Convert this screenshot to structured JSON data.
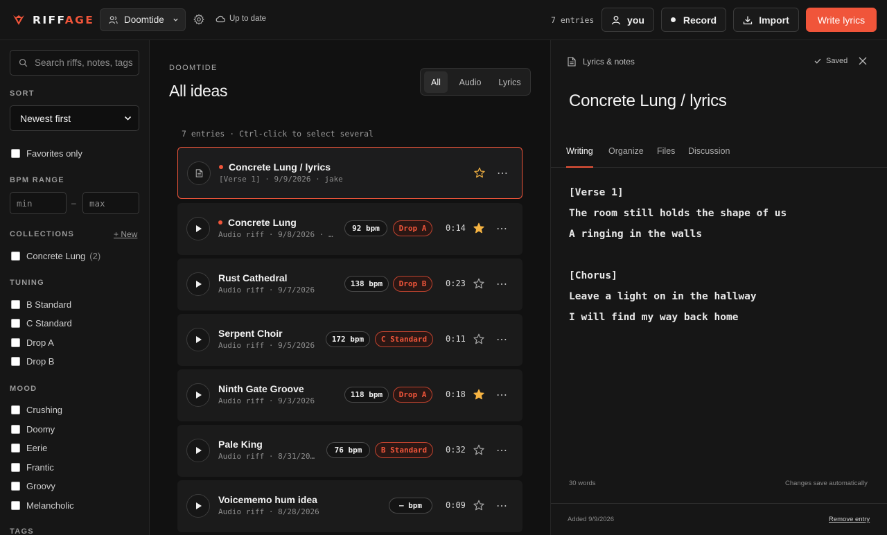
{
  "app": {
    "brand_part1": "RIFF",
    "brand_part2": "AGE",
    "brand_color": "#f0553a",
    "accent_color": "#f0553a",
    "star_color": "#f5b342"
  },
  "header": {
    "project_name": "Doomtide",
    "sync_status": "Up to date",
    "entries_count": "7 entries",
    "user_label": "you",
    "record_label": "Record",
    "import_label": "Import",
    "write_lyrics_label": "Write lyrics"
  },
  "sidebar": {
    "search_placeholder": "Search riffs, notes, tags",
    "sort_label": "SORT",
    "sort_value": "Newest first",
    "favorites_label": "Favorites only",
    "bpm_label": "BPM RANGE",
    "bpm_min_placeholder": "min",
    "bpm_max_placeholder": "max",
    "bpm_dash": "–",
    "collections_label": "COLLECTIONS",
    "new_link": "+ New",
    "collections": [
      {
        "label": "Concrete Lung",
        "count": "(2)"
      }
    ],
    "tuning_label": "TUNING",
    "tunings": [
      "B Standard",
      "C Standard",
      "Drop A",
      "Drop B"
    ],
    "mood_label": "MOOD",
    "moods": [
      "Crushing",
      "Doomy",
      "Eerie",
      "Frantic",
      "Groovy",
      "Melancholic"
    ],
    "tags_label": "TAGS"
  },
  "main": {
    "breadcrumb": "DOOMTIDE",
    "title": "All ideas",
    "filters": [
      "All",
      "Audio",
      "Lyrics"
    ],
    "active_filter": "All",
    "list_info": "7 entries · Ctrl-click to select several",
    "entries": [
      {
        "name": "Concrete Lung / lyrics",
        "sub": "[Verse 1] · 9/9/2026 · jake",
        "kind": "lyrics",
        "dot": true,
        "bpm": "",
        "tuning": "",
        "duration": "",
        "favorite": false,
        "selected": true
      },
      {
        "name": "Concrete Lung",
        "sub": "Audio riff · 9/8/2026 · …",
        "kind": "audio",
        "dot": true,
        "bpm": "92 bpm",
        "tuning": "Drop A",
        "duration": "0:14",
        "favorite": true,
        "selected": false
      },
      {
        "name": "Rust Cathedral",
        "sub": "Audio riff · 9/7/2026",
        "kind": "audio",
        "dot": false,
        "bpm": "138 bpm",
        "tuning": "Drop B",
        "duration": "0:23",
        "favorite": false,
        "selected": false
      },
      {
        "name": "Serpent Choir",
        "sub": "Audio riff · 9/5/2026",
        "kind": "audio",
        "dot": false,
        "bpm": "172 bpm",
        "tuning": "C Standard",
        "duration": "0:11",
        "favorite": false,
        "selected": false
      },
      {
        "name": "Ninth Gate Groove",
        "sub": "Audio riff · 9/3/2026",
        "kind": "audio",
        "dot": false,
        "bpm": "118 bpm",
        "tuning": "Drop A",
        "duration": "0:18",
        "favorite": true,
        "selected": false
      },
      {
        "name": "Pale King",
        "sub": "Audio riff · 8/31/20…",
        "kind": "audio",
        "dot": false,
        "bpm": "76 bpm",
        "tuning": "B Standard",
        "duration": "0:32",
        "favorite": false,
        "selected": false
      },
      {
        "name": "Voicememo hum idea",
        "sub": "Audio riff · 8/28/2026",
        "kind": "audio",
        "dot": false,
        "bpm": "– bpm",
        "tuning": "",
        "duration": "0:09",
        "favorite": false,
        "selected": false
      }
    ]
  },
  "panel": {
    "header": "Lyrics & notes",
    "saved_label": "Saved",
    "title": "Concrete Lung / lyrics",
    "tabs": [
      "Writing",
      "Organize",
      "Files",
      "Discussion"
    ],
    "active_tab": "Writing",
    "lyrics": [
      "[Verse 1]",
      "The room still holds the shape of us",
      "A ringing in the walls",
      "",
      "[Chorus]",
      "Leave a light on in the hallway",
      "I will find my way back home"
    ],
    "word_count": "30 words",
    "autosave_note": "Changes save automatically",
    "added": "Added 9/9/2026",
    "remove_label": "Remove entry"
  }
}
